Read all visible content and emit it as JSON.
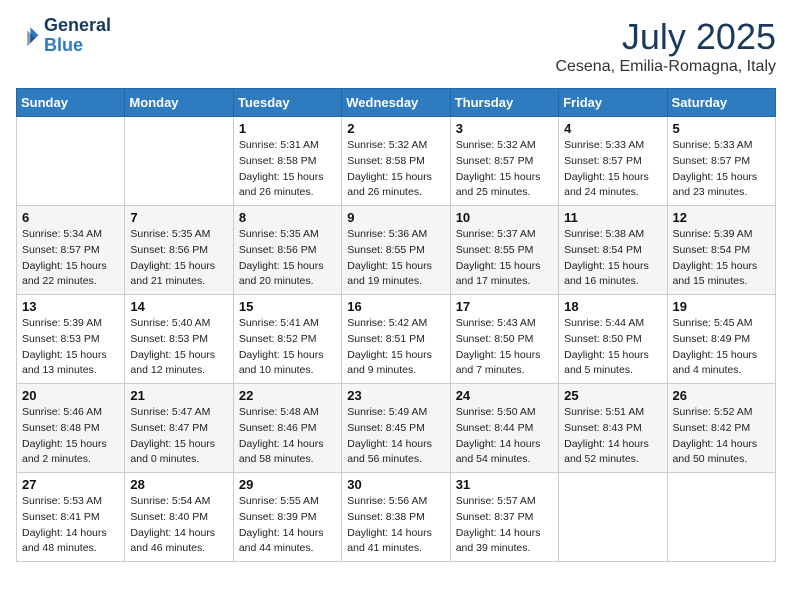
{
  "header": {
    "logo_line1": "General",
    "logo_line2": "Blue",
    "month_title": "July 2025",
    "location": "Cesena, Emilia-Romagna, Italy"
  },
  "days_of_week": [
    "Sunday",
    "Monday",
    "Tuesday",
    "Wednesday",
    "Thursday",
    "Friday",
    "Saturday"
  ],
  "weeks": [
    [
      {
        "day": "",
        "info": ""
      },
      {
        "day": "",
        "info": ""
      },
      {
        "day": "1",
        "info": "Sunrise: 5:31 AM\nSunset: 8:58 PM\nDaylight: 15 hours\nand 26 minutes."
      },
      {
        "day": "2",
        "info": "Sunrise: 5:32 AM\nSunset: 8:58 PM\nDaylight: 15 hours\nand 26 minutes."
      },
      {
        "day": "3",
        "info": "Sunrise: 5:32 AM\nSunset: 8:57 PM\nDaylight: 15 hours\nand 25 minutes."
      },
      {
        "day": "4",
        "info": "Sunrise: 5:33 AM\nSunset: 8:57 PM\nDaylight: 15 hours\nand 24 minutes."
      },
      {
        "day": "5",
        "info": "Sunrise: 5:33 AM\nSunset: 8:57 PM\nDaylight: 15 hours\nand 23 minutes."
      }
    ],
    [
      {
        "day": "6",
        "info": "Sunrise: 5:34 AM\nSunset: 8:57 PM\nDaylight: 15 hours\nand 22 minutes."
      },
      {
        "day": "7",
        "info": "Sunrise: 5:35 AM\nSunset: 8:56 PM\nDaylight: 15 hours\nand 21 minutes."
      },
      {
        "day": "8",
        "info": "Sunrise: 5:35 AM\nSunset: 8:56 PM\nDaylight: 15 hours\nand 20 minutes."
      },
      {
        "day": "9",
        "info": "Sunrise: 5:36 AM\nSunset: 8:55 PM\nDaylight: 15 hours\nand 19 minutes."
      },
      {
        "day": "10",
        "info": "Sunrise: 5:37 AM\nSunset: 8:55 PM\nDaylight: 15 hours\nand 17 minutes."
      },
      {
        "day": "11",
        "info": "Sunrise: 5:38 AM\nSunset: 8:54 PM\nDaylight: 15 hours\nand 16 minutes."
      },
      {
        "day": "12",
        "info": "Sunrise: 5:39 AM\nSunset: 8:54 PM\nDaylight: 15 hours\nand 15 minutes."
      }
    ],
    [
      {
        "day": "13",
        "info": "Sunrise: 5:39 AM\nSunset: 8:53 PM\nDaylight: 15 hours\nand 13 minutes."
      },
      {
        "day": "14",
        "info": "Sunrise: 5:40 AM\nSunset: 8:53 PM\nDaylight: 15 hours\nand 12 minutes."
      },
      {
        "day": "15",
        "info": "Sunrise: 5:41 AM\nSunset: 8:52 PM\nDaylight: 15 hours\nand 10 minutes."
      },
      {
        "day": "16",
        "info": "Sunrise: 5:42 AM\nSunset: 8:51 PM\nDaylight: 15 hours\nand 9 minutes."
      },
      {
        "day": "17",
        "info": "Sunrise: 5:43 AM\nSunset: 8:50 PM\nDaylight: 15 hours\nand 7 minutes."
      },
      {
        "day": "18",
        "info": "Sunrise: 5:44 AM\nSunset: 8:50 PM\nDaylight: 15 hours\nand 5 minutes."
      },
      {
        "day": "19",
        "info": "Sunrise: 5:45 AM\nSunset: 8:49 PM\nDaylight: 15 hours\nand 4 minutes."
      }
    ],
    [
      {
        "day": "20",
        "info": "Sunrise: 5:46 AM\nSunset: 8:48 PM\nDaylight: 15 hours\nand 2 minutes."
      },
      {
        "day": "21",
        "info": "Sunrise: 5:47 AM\nSunset: 8:47 PM\nDaylight: 15 hours\nand 0 minutes."
      },
      {
        "day": "22",
        "info": "Sunrise: 5:48 AM\nSunset: 8:46 PM\nDaylight: 14 hours\nand 58 minutes."
      },
      {
        "day": "23",
        "info": "Sunrise: 5:49 AM\nSunset: 8:45 PM\nDaylight: 14 hours\nand 56 minutes."
      },
      {
        "day": "24",
        "info": "Sunrise: 5:50 AM\nSunset: 8:44 PM\nDaylight: 14 hours\nand 54 minutes."
      },
      {
        "day": "25",
        "info": "Sunrise: 5:51 AM\nSunset: 8:43 PM\nDaylight: 14 hours\nand 52 minutes."
      },
      {
        "day": "26",
        "info": "Sunrise: 5:52 AM\nSunset: 8:42 PM\nDaylight: 14 hours\nand 50 minutes."
      }
    ],
    [
      {
        "day": "27",
        "info": "Sunrise: 5:53 AM\nSunset: 8:41 PM\nDaylight: 14 hours\nand 48 minutes."
      },
      {
        "day": "28",
        "info": "Sunrise: 5:54 AM\nSunset: 8:40 PM\nDaylight: 14 hours\nand 46 minutes."
      },
      {
        "day": "29",
        "info": "Sunrise: 5:55 AM\nSunset: 8:39 PM\nDaylight: 14 hours\nand 44 minutes."
      },
      {
        "day": "30",
        "info": "Sunrise: 5:56 AM\nSunset: 8:38 PM\nDaylight: 14 hours\nand 41 minutes."
      },
      {
        "day": "31",
        "info": "Sunrise: 5:57 AM\nSunset: 8:37 PM\nDaylight: 14 hours\nand 39 minutes."
      },
      {
        "day": "",
        "info": ""
      },
      {
        "day": "",
        "info": ""
      }
    ]
  ]
}
